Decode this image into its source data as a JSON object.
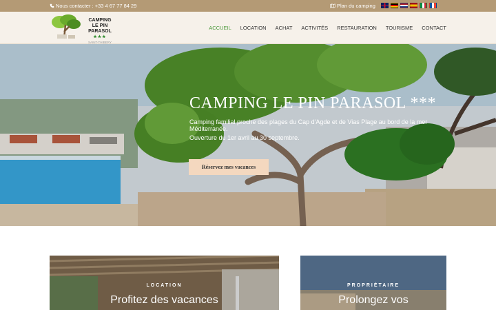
{
  "topbar": {
    "contact": "Nous contacter : +33 4 67 77 84 29",
    "plan": "Plan du camping",
    "flags": [
      "english-flag-icon",
      "german-flag-icon",
      "dutch-flag-icon",
      "spanish-flag-icon",
      "italian-flag-icon",
      "french-flag-icon"
    ]
  },
  "logo": {
    "line1": "CAMPING",
    "line2": "LE PIN PARASOL",
    "stars": "★★★",
    "sub": "SAINT-THIBERY"
  },
  "nav": {
    "items": [
      "ACCUEIL",
      "LOCATION",
      "ACHAT",
      "ACTIVITÉS",
      "RESTAURATION",
      "TOURISME",
      "CONTACT"
    ],
    "active_index": 0
  },
  "hero": {
    "title": "CAMPING LE PIN PARASOL ***",
    "subtitle": "Camping familial proche des plages du Cap d'Agde et de Vias Plage au bord de la mer Méditerranée.",
    "opening": "Ouverture du 1er avril au 30 septembre.",
    "button": "Réservez mes vacances"
  },
  "cards": [
    {
      "kicker": "LOCATION",
      "title": "Profitez des vacances"
    },
    {
      "kicker": "PROPRIÉTAIRE",
      "title": "Prolongez vos"
    }
  ],
  "colors": {
    "topbar": "#b49a75",
    "nav_active": "#4d9a3c",
    "button": "#f4d8bf",
    "foliage": "#4f8d2a"
  }
}
